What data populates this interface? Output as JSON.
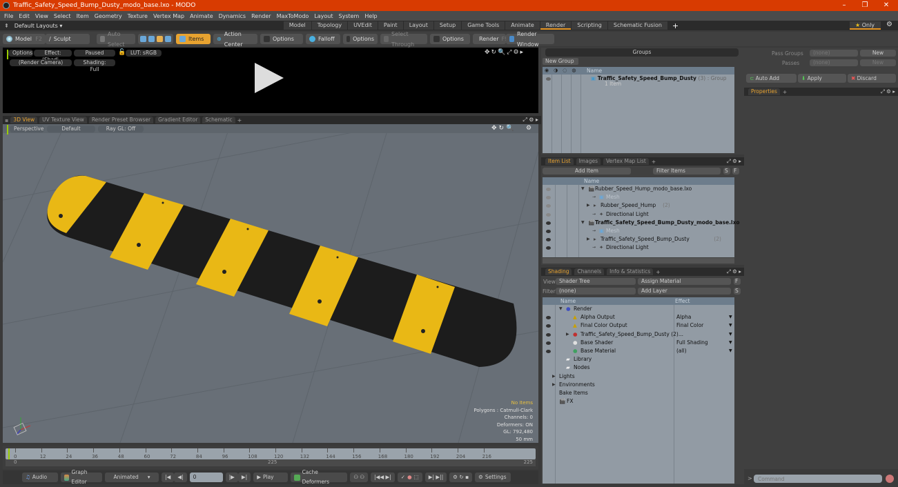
{
  "window": {
    "title": "Traffic_Safety_Speed_Bump_Dusty_modo_base.lxo - MODO",
    "controls": {
      "minimize": "–",
      "maximize": "❐",
      "close": "✕"
    }
  },
  "menu": [
    "File",
    "Edit",
    "View",
    "Select",
    "Item",
    "Geometry",
    "Texture",
    "Vertex Map",
    "Animate",
    "Dynamics",
    "Render",
    "MaxToModo",
    "Layout",
    "System",
    "Help"
  ],
  "layouts": {
    "selector": "Default Layouts ▾",
    "tabs": [
      "Model",
      "Topology",
      "UVEdit",
      "Paint",
      "Layout",
      "Setup",
      "Game Tools",
      "Animate",
      "Render",
      "Scripting",
      "Schematic Fusion"
    ],
    "active": "Render",
    "add": "+",
    "only_label": "Only"
  },
  "toolbar": {
    "model": "Model",
    "model_key": "F2",
    "sculpt": "Sculpt",
    "auto_select": "Auto Select",
    "items": "Items",
    "action_center": "Action Center",
    "options1": "Options",
    "falloff": "Falloff",
    "options2": "Options",
    "select_through": "Select Through",
    "options3": "Options",
    "render": "Render",
    "render_key": "F9",
    "render_window": "Render Window"
  },
  "preview": {
    "options": "Options",
    "effect": "Effect: (Shadi...",
    "paused": "Paused",
    "lut": "LUT: sRGB",
    "camera": "(Render Camera)",
    "shading": "Shading: Full"
  },
  "viewport_tabs": [
    "3D View",
    "UV Texture View",
    "Render Preset Browser",
    "Gradient Editor",
    "Schematic"
  ],
  "viewport": {
    "perspective": "Perspective",
    "default": "Default",
    "raygl": "Ray GL: Off",
    "hud": {
      "items": "No Items",
      "polygons": "Polygons : Catmull-Clark",
      "channels": "Channels: 0",
      "deformers": "Deformers: ON",
      "gl": "GL: 792,480",
      "focal": "50 mm"
    }
  },
  "timeline": {
    "ticks": [
      "0",
      "12",
      "24",
      "36",
      "48",
      "60",
      "72",
      "84",
      "96",
      "108",
      "120",
      "132",
      "144",
      "156",
      "168",
      "180",
      "192",
      "204",
      "216"
    ],
    "start": "0",
    "end": "225",
    "end2": "225",
    "current_frame": "0"
  },
  "bottom": {
    "audio": "Audio",
    "graph_editor": "Graph Editor",
    "animated": "Animated",
    "play": "Play",
    "cache_deformers": "Cache Deformers",
    "settings": "Settings"
  },
  "groups": {
    "title": "Groups",
    "new_group": "New Group",
    "col_name": "Name",
    "item_name": "Traffic_Safety_Speed_Bump_Dusty",
    "item_count": "(3)",
    "item_type": ": Group",
    "item_sub": "1 Item"
  },
  "passes": {
    "pass_groups_label": "Pass Groups",
    "pass_groups_value": "(none)",
    "passes_label": "Passes",
    "passes_value": "(none)",
    "new": "New",
    "auto_add": "Auto Add",
    "apply": "Apply",
    "discard": "Discard",
    "properties_tab": "Properties"
  },
  "item_list": {
    "tabs": [
      "Item List",
      "Images",
      "Vertex Map List"
    ],
    "add_item": "Add Item",
    "filter": "Filter Items",
    "s": "S",
    "f": "F",
    "col_name": "Name",
    "rows": [
      {
        "name": "Rubber_Speed_Hump_modo_base.lxo",
        "indent": 0,
        "bold": false,
        "dim": false,
        "arrow": "▼",
        "suffix": ""
      },
      {
        "name": "Mesh",
        "indent": 2,
        "bold": false,
        "dim": true,
        "arrow": "",
        "suffix": ""
      },
      {
        "name": "Rubber_Speed_Hump",
        "indent": 1,
        "bold": false,
        "dim": false,
        "arrow": "▶",
        "suffix": "(2)"
      },
      {
        "name": "Directional Light",
        "indent": 2,
        "bold": false,
        "dim": false,
        "arrow": "",
        "suffix": ""
      },
      {
        "name": "Traffic_Safety_Speed_Bump_Dusty_modo_base.lxo",
        "indent": 0,
        "bold": true,
        "dim": false,
        "arrow": "▼",
        "suffix": ""
      },
      {
        "name": "Mesh",
        "indent": 2,
        "bold": false,
        "dim": true,
        "arrow": "",
        "suffix": ""
      },
      {
        "name": "Traffic_Safety_Speed_Bump_Dusty",
        "indent": 1,
        "bold": false,
        "dim": false,
        "arrow": "▶",
        "suffix": "(2)"
      },
      {
        "name": "Directional Light",
        "indent": 2,
        "bold": false,
        "dim": false,
        "arrow": "",
        "suffix": ""
      }
    ]
  },
  "shading": {
    "tabs": [
      "Shading",
      "Channels",
      "Info & Statistics"
    ],
    "view_label": "View",
    "view_value": "Shader Tree",
    "assign_material": "Assign Material",
    "filter_label": "Filter",
    "filter_value": "(none)",
    "add_layer": "Add Layer",
    "f": "F",
    "s": "S",
    "col_name": "Name",
    "col_effect": "Effect",
    "rows": [
      {
        "name": "Render",
        "effect": "",
        "icon": "render-sphere",
        "indent": 0,
        "eye": false
      },
      {
        "name": "Alpha Output",
        "effect": "Alpha",
        "icon": "output",
        "indent": 1,
        "eye": true
      },
      {
        "name": "Final Color Output",
        "effect": "Final Color",
        "icon": "output",
        "indent": 1,
        "eye": true
      },
      {
        "name": "Traffic_Safety_Speed_Bump_Dusty (2)...",
        "effect": "",
        "icon": "material-group",
        "indent": 1,
        "eye": true
      },
      {
        "name": "Base Shader",
        "effect": "Full Shading",
        "icon": "shader",
        "indent": 1,
        "eye": true
      },
      {
        "name": "Base Material",
        "effect": "(all)",
        "icon": "material",
        "indent": 1,
        "eye": true
      },
      {
        "name": "Library",
        "effect": "",
        "icon": "folder",
        "indent": 0,
        "eye": false
      },
      {
        "name": "Nodes",
        "effect": "",
        "icon": "folder",
        "indent": 0,
        "eye": false
      },
      {
        "name": "Lights",
        "effect": "",
        "icon": "",
        "indent": -1,
        "eye": false
      },
      {
        "name": "Environments",
        "effect": "",
        "icon": "",
        "indent": -1,
        "eye": false
      },
      {
        "name": "Bake Items",
        "effect": "",
        "icon": "",
        "indent": -1,
        "eye": false
      },
      {
        "name": "FX",
        "effect": "",
        "icon": "fx",
        "indent": -1,
        "eye": false
      }
    ]
  },
  "command": {
    "placeholder": "Command"
  },
  "colors": {
    "accent": "#e8a330",
    "title_bar": "#d83b01"
  }
}
